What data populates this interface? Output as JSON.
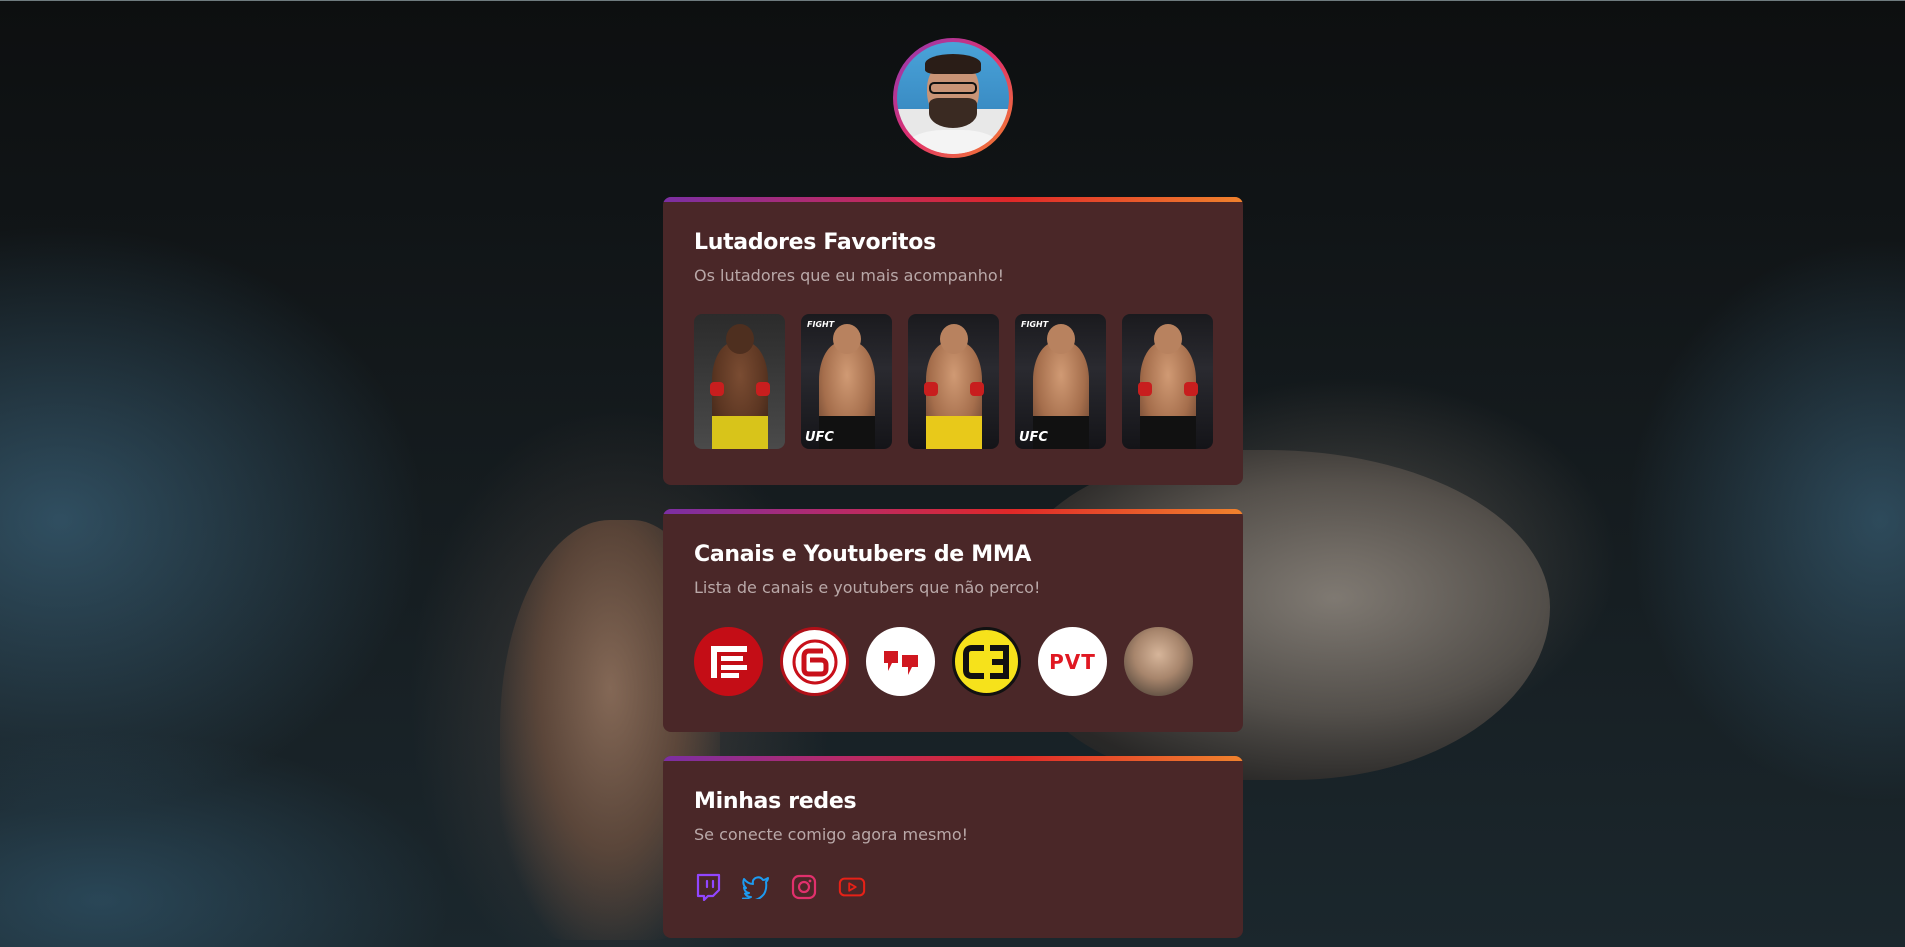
{
  "profile": {
    "avatar_icon": "profile-photo"
  },
  "fighters_section": {
    "title": "Lutadores Favoritos",
    "subtitle": "Os lutadores que eu mais acompanho!",
    "fighters": [
      {
        "badge": ""
      },
      {
        "badge": "UFC"
      },
      {
        "badge": ""
      },
      {
        "badge": "UFC"
      },
      {
        "badge": ""
      }
    ]
  },
  "channels_section": {
    "title": "Canais e Youtubers de MMA",
    "subtitle": "Lista de canais e youtubers que não perco!",
    "channels": [
      {
        "glyph": "≡"
      },
      {
        "glyph": "6"
      },
      {
        "glyph": "❛❜"
      },
      {
        "glyph": "CƎ"
      },
      {
        "glyph": "PVT"
      },
      {
        "glyph": ""
      }
    ]
  },
  "social_section": {
    "title": "Minhas redes",
    "subtitle": "Se conecte comigo agora mesmo!",
    "icons": [
      "twitch-icon",
      "twitter-icon",
      "instagram-icon",
      "youtube-icon"
    ]
  },
  "colors": {
    "card_bg": "#4a2728",
    "accent_gradient": [
      "#7b2fa3",
      "#e02828",
      "#f0822d"
    ],
    "twitch": "#9146ff",
    "twitter": "#1d9bf0",
    "instagram": "#e1306c",
    "youtube": "#e62117"
  }
}
